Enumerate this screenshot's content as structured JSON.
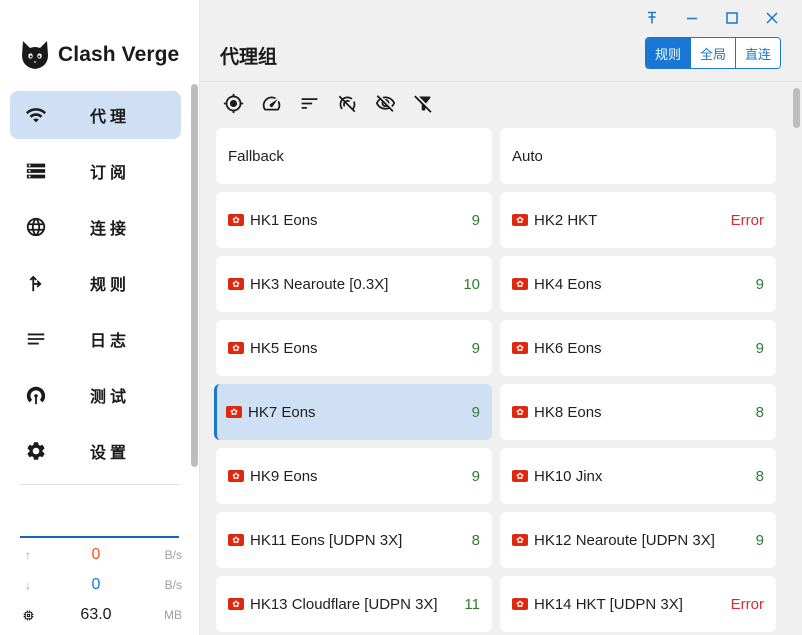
{
  "app": {
    "name": "Clash Verge"
  },
  "sidebar": {
    "items": [
      {
        "label": "代理",
        "icon": "wifi-icon",
        "active": true
      },
      {
        "label": "订阅",
        "icon": "storage-icon",
        "active": false
      },
      {
        "label": "连接",
        "icon": "globe-icon",
        "active": false
      },
      {
        "label": "规则",
        "icon": "route-fork-icon",
        "active": false
      },
      {
        "label": "日志",
        "icon": "notes-icon",
        "active": false
      },
      {
        "label": "测试",
        "icon": "radar-icon",
        "active": false
      },
      {
        "label": "设置",
        "icon": "gear-icon",
        "active": false
      }
    ],
    "traffic": {
      "upload": {
        "value": "0",
        "unit": "B/s",
        "icon": "arrow-up-icon",
        "color": "#f4511e"
      },
      "download": {
        "value": "0",
        "unit": "B/s",
        "icon": "arrow-down-icon",
        "color": "#1976d2"
      },
      "memory": {
        "value": "63.0",
        "unit": "MB",
        "icon": "memory-icon"
      }
    }
  },
  "header": {
    "title": "代理组",
    "modes": [
      {
        "label": "规则",
        "active": true
      },
      {
        "label": "全局",
        "active": false
      },
      {
        "label": "直连",
        "active": false
      }
    ]
  },
  "toolbar": {
    "icons": [
      "locate-icon",
      "speed-test-icon",
      "sort-icon",
      "hide-delay-icon",
      "eye-off-icon",
      "filter-off-icon"
    ]
  },
  "proxies": [
    {
      "name": "Fallback",
      "delay": "",
      "flag": false,
      "selected": false
    },
    {
      "name": "Auto",
      "delay": "",
      "flag": false,
      "selected": false
    },
    {
      "name": "HK1 Eons",
      "delay": "9",
      "flag": true,
      "selected": false
    },
    {
      "name": "HK2 HKT",
      "delay": "Error",
      "flag": true,
      "selected": false
    },
    {
      "name": "HK3 Nearoute [0.3X]",
      "delay": "10",
      "flag": true,
      "selected": false
    },
    {
      "name": "HK4 Eons",
      "delay": "9",
      "flag": true,
      "selected": false
    },
    {
      "name": "HK5 Eons",
      "delay": "9",
      "flag": true,
      "selected": false
    },
    {
      "name": "HK6 Eons",
      "delay": "9",
      "flag": true,
      "selected": false
    },
    {
      "name": "HK7 Eons",
      "delay": "9",
      "flag": true,
      "selected": true
    },
    {
      "name": "HK8 Eons",
      "delay": "8",
      "flag": true,
      "selected": false
    },
    {
      "name": "HK9 Eons",
      "delay": "9",
      "flag": true,
      "selected": false
    },
    {
      "name": "HK10 Jinx",
      "delay": "8",
      "flag": true,
      "selected": false
    },
    {
      "name": "HK11 Eons [UDPN 3X]",
      "delay": "8",
      "flag": true,
      "selected": false
    },
    {
      "name": "HK12 Nearoute [UDPN 3X]",
      "delay": "9",
      "flag": true,
      "selected": false
    },
    {
      "name": "HK13 Cloudflare [UDPN 3X]",
      "delay": "11",
      "flag": true,
      "selected": false
    },
    {
      "name": "HK14 HKT [UDPN 3X]",
      "delay": "Error",
      "flag": true,
      "selected": false
    }
  ],
  "colors": {
    "accent": "#1976d2",
    "selected_bg": "#cfe0f5",
    "ok": "#2e7d32",
    "error": "#d32f2f"
  }
}
